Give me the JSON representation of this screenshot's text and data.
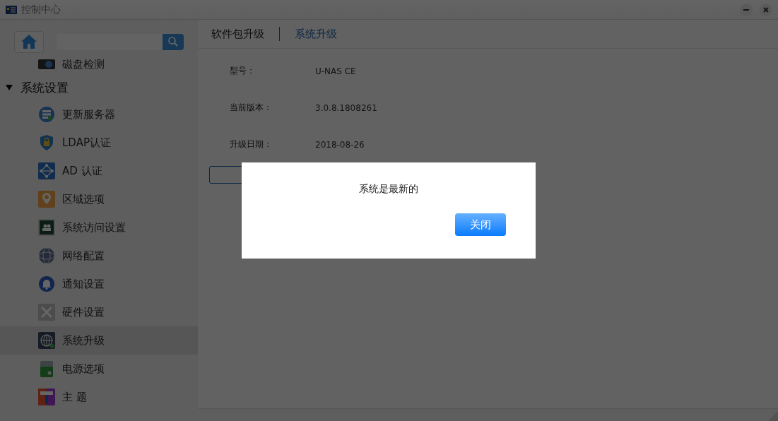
{
  "window": {
    "title": "控制中心"
  },
  "sidebar": {
    "partial_item": "磁盘检测",
    "section": {
      "label": "系统设置",
      "expanded": true
    },
    "items": [
      {
        "label": "更新服务器",
        "selected": false
      },
      {
        "label": "LDAP认证",
        "selected": false
      },
      {
        "label": "AD 认证",
        "selected": false
      },
      {
        "label": "区域选项",
        "selected": false
      },
      {
        "label": "系统访问设置",
        "selected": false
      },
      {
        "label": "网络配置",
        "selected": false
      },
      {
        "label": "通知设置",
        "selected": false
      },
      {
        "label": "硬件设置",
        "selected": false
      },
      {
        "label": "系统升级",
        "selected": true
      },
      {
        "label": "电源选项",
        "selected": false
      },
      {
        "label": "主 题",
        "selected": false
      }
    ]
  },
  "tabs": [
    {
      "label": "软件包升级",
      "selected": false
    },
    {
      "label": "系统升级",
      "selected": true
    }
  ],
  "info": [
    {
      "label": "型号：",
      "value": "U-NAS CE"
    },
    {
      "label": "当前版本：",
      "value": "3.0.8.1808261"
    },
    {
      "label": "升级日期：",
      "value": "2018-08-26"
    }
  ],
  "dialog": {
    "message": "系统是最新的",
    "button": "关闭"
  }
}
